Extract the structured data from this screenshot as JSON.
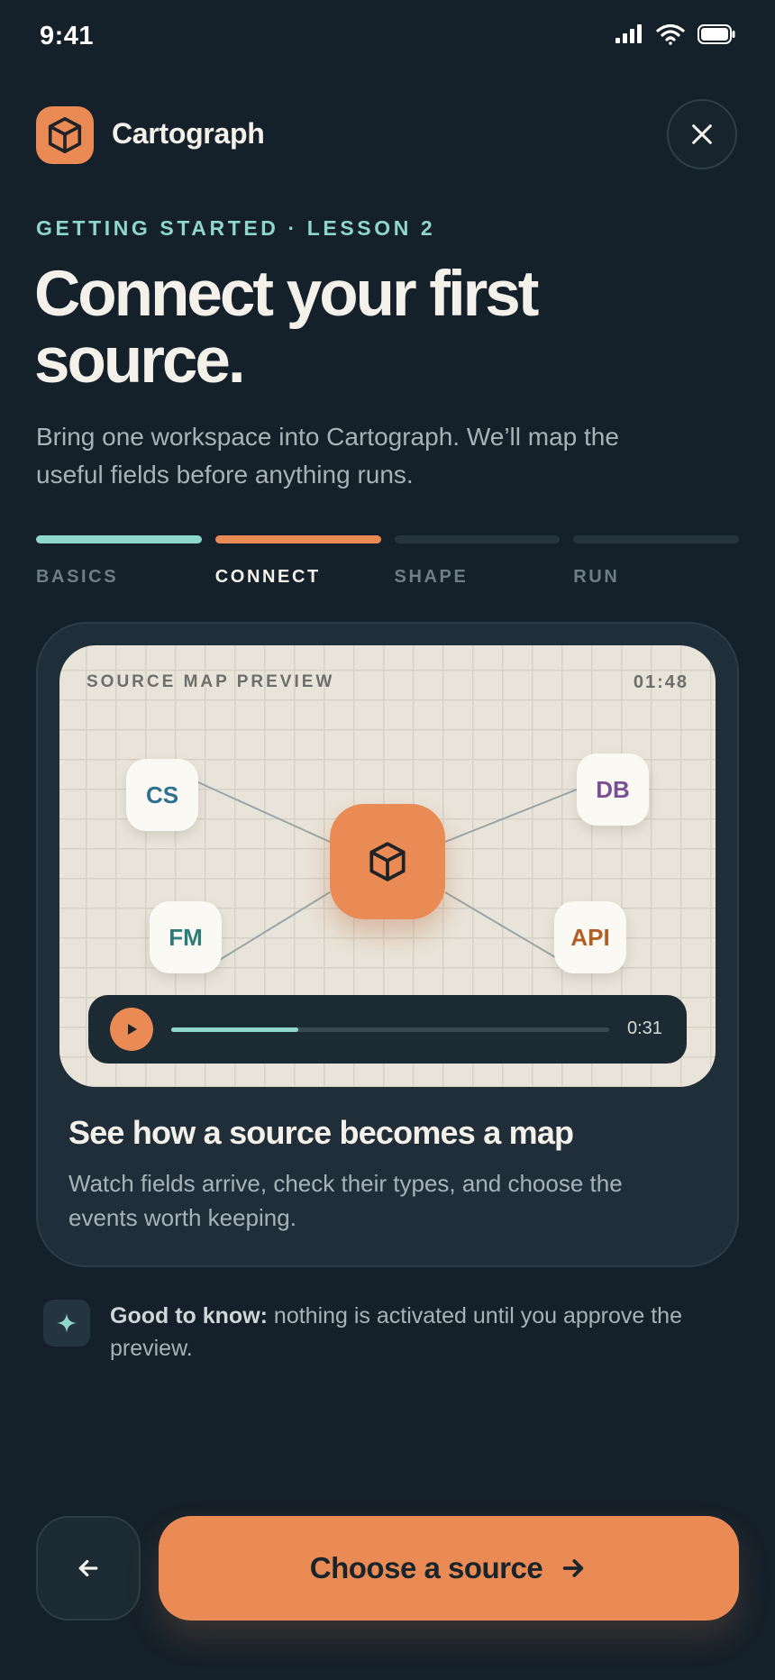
{
  "status": {
    "time": "9:41"
  },
  "header": {
    "brand": "Cartograph",
    "logo_icon": "cube-icon",
    "close_icon": "close-icon"
  },
  "lesson": {
    "eyebrow": "GETTING STARTED · LESSON 2",
    "title_line1": "Connect your first",
    "title_line2": "source.",
    "subtitle": "Bring one workspace into Cartograph. We’ll map the useful fields before anything runs."
  },
  "steps": [
    {
      "label": "BASICS",
      "state": "done"
    },
    {
      "label": "CONNECT",
      "state": "active"
    },
    {
      "label": "SHAPE",
      "state": "upcoming"
    },
    {
      "label": "RUN",
      "state": "upcoming"
    }
  ],
  "preview": {
    "label": "SOURCE MAP PREVIEW",
    "duration": "01:48",
    "nodes": {
      "cs": "CS",
      "db": "DB",
      "fm": "FM",
      "api": "API"
    },
    "player": {
      "current_time": "0:31",
      "progress": 0.29
    }
  },
  "card": {
    "title": "See how a source becomes a map",
    "description": "Watch fields arrive, check their types, and choose the events worth keeping."
  },
  "tip": {
    "strong": "Good to know:",
    "text": " nothing is activated until you approve the preview."
  },
  "actions": {
    "primary_label": "Choose a source",
    "back_icon": "arrow-left-icon"
  },
  "colors": {
    "accent": "#ea8b55",
    "teal": "#8fd6cc",
    "background": "#14202a"
  }
}
